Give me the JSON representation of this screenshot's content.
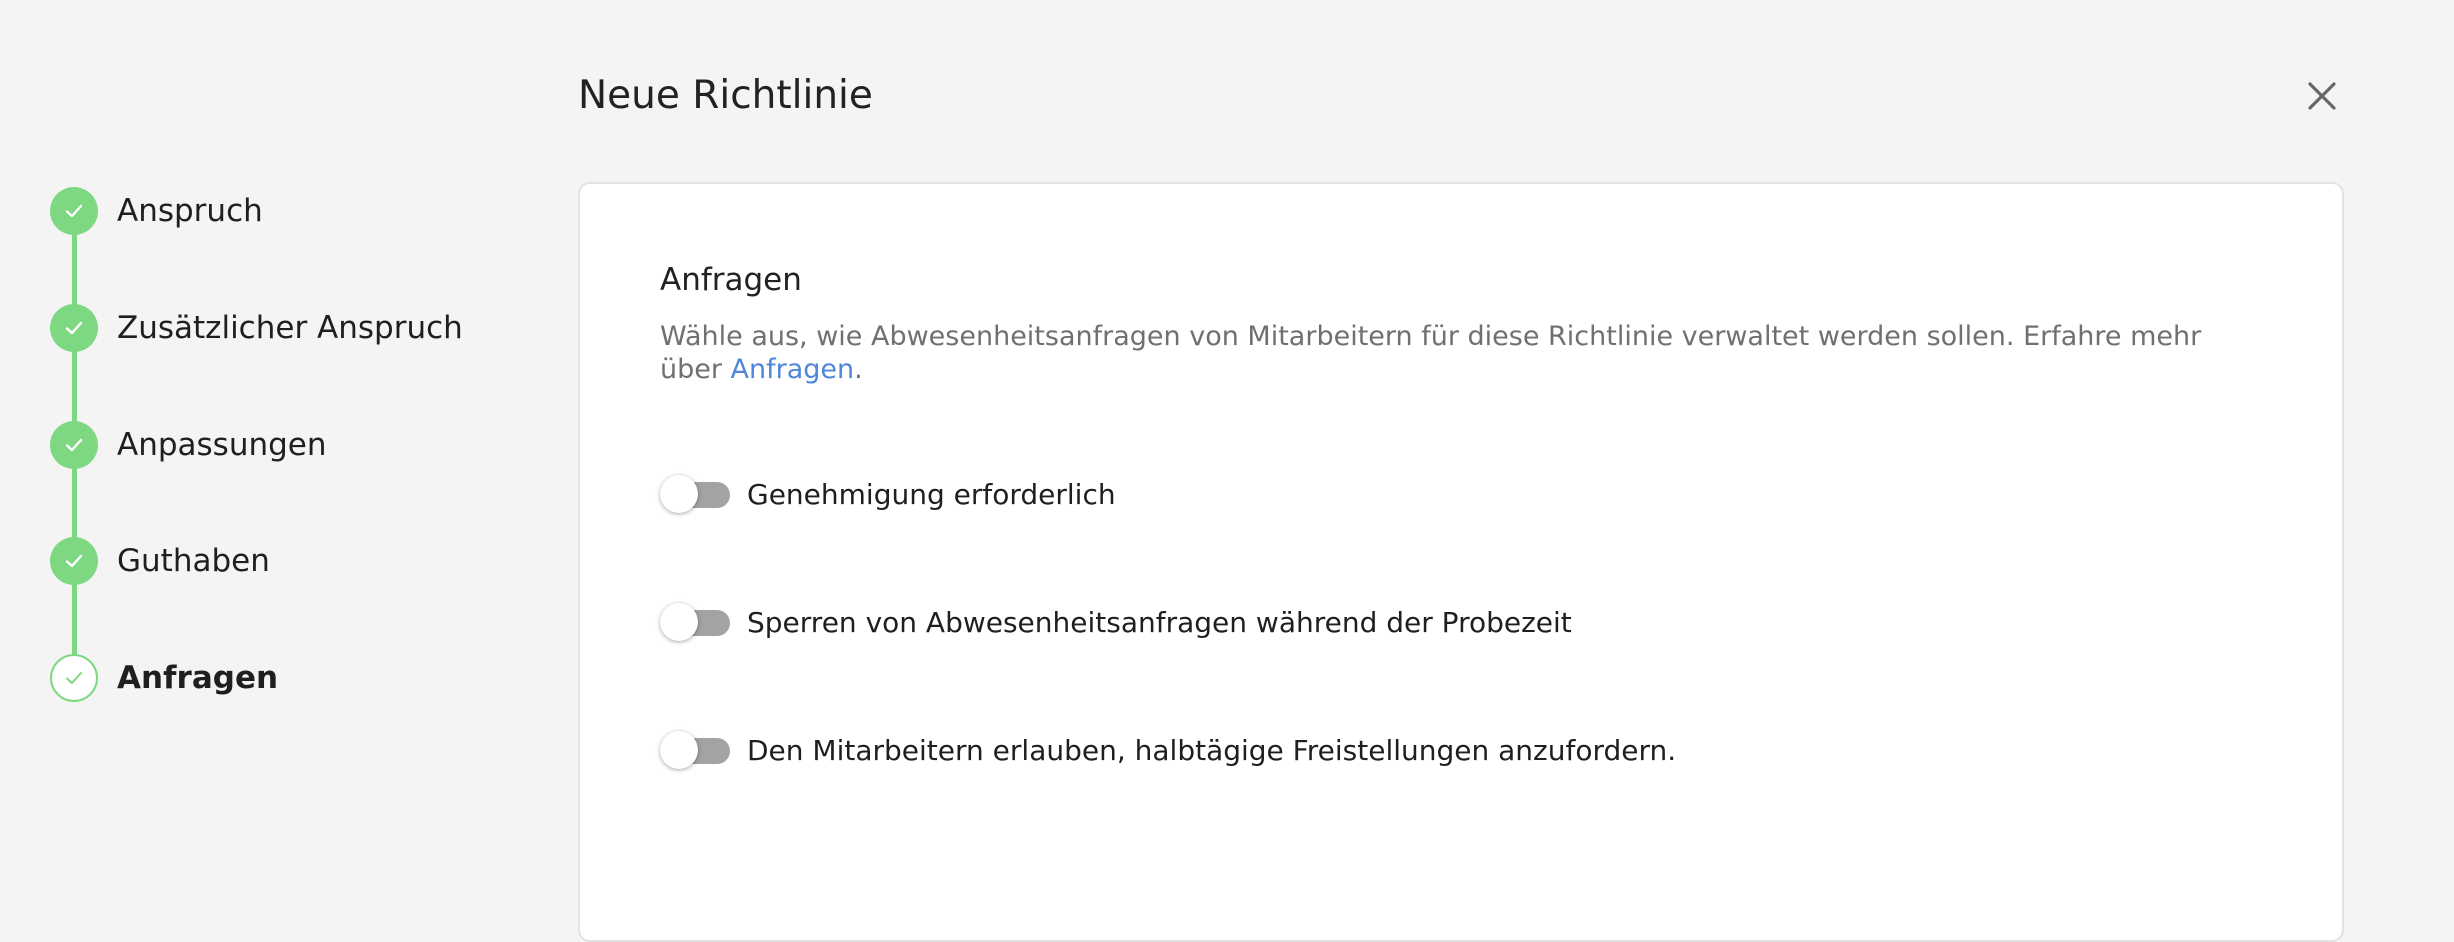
{
  "header": {
    "title": "Neue Richtlinie",
    "close_icon": "close-icon"
  },
  "stepper": {
    "accent_color": "#7ed882",
    "steps": [
      {
        "label": "Anspruch",
        "state": "completed",
        "icon": "check-icon"
      },
      {
        "label": "Zusätzlicher Anspruch",
        "state": "completed",
        "icon": "check-icon"
      },
      {
        "label": "Anpassungen",
        "state": "completed",
        "icon": "check-icon"
      },
      {
        "label": "Guthaben",
        "state": "completed",
        "icon": "check-icon"
      },
      {
        "label": "Anfragen",
        "state": "current",
        "icon": "check-icon"
      }
    ]
  },
  "section": {
    "title": "Anfragen",
    "description_prefix": "Wähle aus, wie Abwesenheitsanfragen von Mitarbeitern für diese Richtlinie verwaltet werden sollen. Erfahre mehr über ",
    "description_link": "Anfragen",
    "description_suffix": ".",
    "link_color": "#4f86d9"
  },
  "toggles": [
    {
      "label": "Genehmigung erforderlich",
      "enabled": false
    },
    {
      "label": "Sperren von Abwesenheitsanfragen während der Probezeit",
      "enabled": false
    },
    {
      "label": "Den Mitarbeitern erlauben, halbtägige Freistellungen anzufordern.",
      "enabled": false
    }
  ]
}
